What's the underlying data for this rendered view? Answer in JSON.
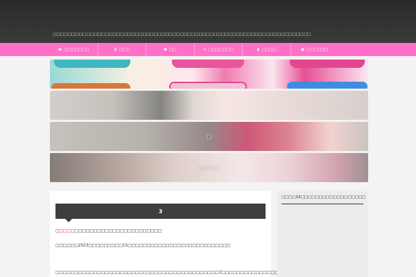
{
  "header": {
    "tagline": "□□□□□□□□□□□□□□□□□□□□□□□□□□□□□□□□□□□□□□□□□□□□□□□□□□□□□□□□□□□□□□□□□□□□□"
  },
  "nav": {
    "items": [
      {
        "label": "□□□□□□□",
        "icon": "card-icon"
      },
      {
        "label": "□□□",
        "icon": "pin-icon"
      },
      {
        "label": "□□",
        "icon": "heart-icon"
      },
      {
        "label": "□□□□□□□",
        "icon": "pin-icon"
      },
      {
        "label": "□□□□",
        "icon": "pin-icon"
      },
      {
        "label": "□□□□□□",
        "icon": "clock-icon"
      }
    ]
  },
  "banners": [
    {
      "label": ""
    },
    {
      "label": ""
    },
    {
      "label": "□"
    },
    {
      "label": "□□□□"
    }
  ],
  "post": {
    "heading": "3",
    "line1_prefix": "□",
    "line1_highlight": "□□□□",
    "line1_suffix": "□□□□□□□□□□□□□□□□□□□□□□□",
    "line2": "□□□□□□2023□□□□□□□□□15□□□□□□□□□□□□□□□□□□□□□□□□□□□",
    "line3": "□□□□□□□□□□□□□□□□□□□□□□□□□□□□□□□□□□□□□□□□□□□3□□□□□□□□□□□□□□□□□□□□□□□□□□□□□□"
  },
  "sidebar": {
    "title": "□□□□15□□□□□□□□□□□□□□□□□□"
  },
  "colors": {
    "nav_bg": "#ff70c8",
    "header_bg": "#2f2f2f",
    "heading_bg": "#3e3e3e",
    "highlight": "#e0245e"
  }
}
